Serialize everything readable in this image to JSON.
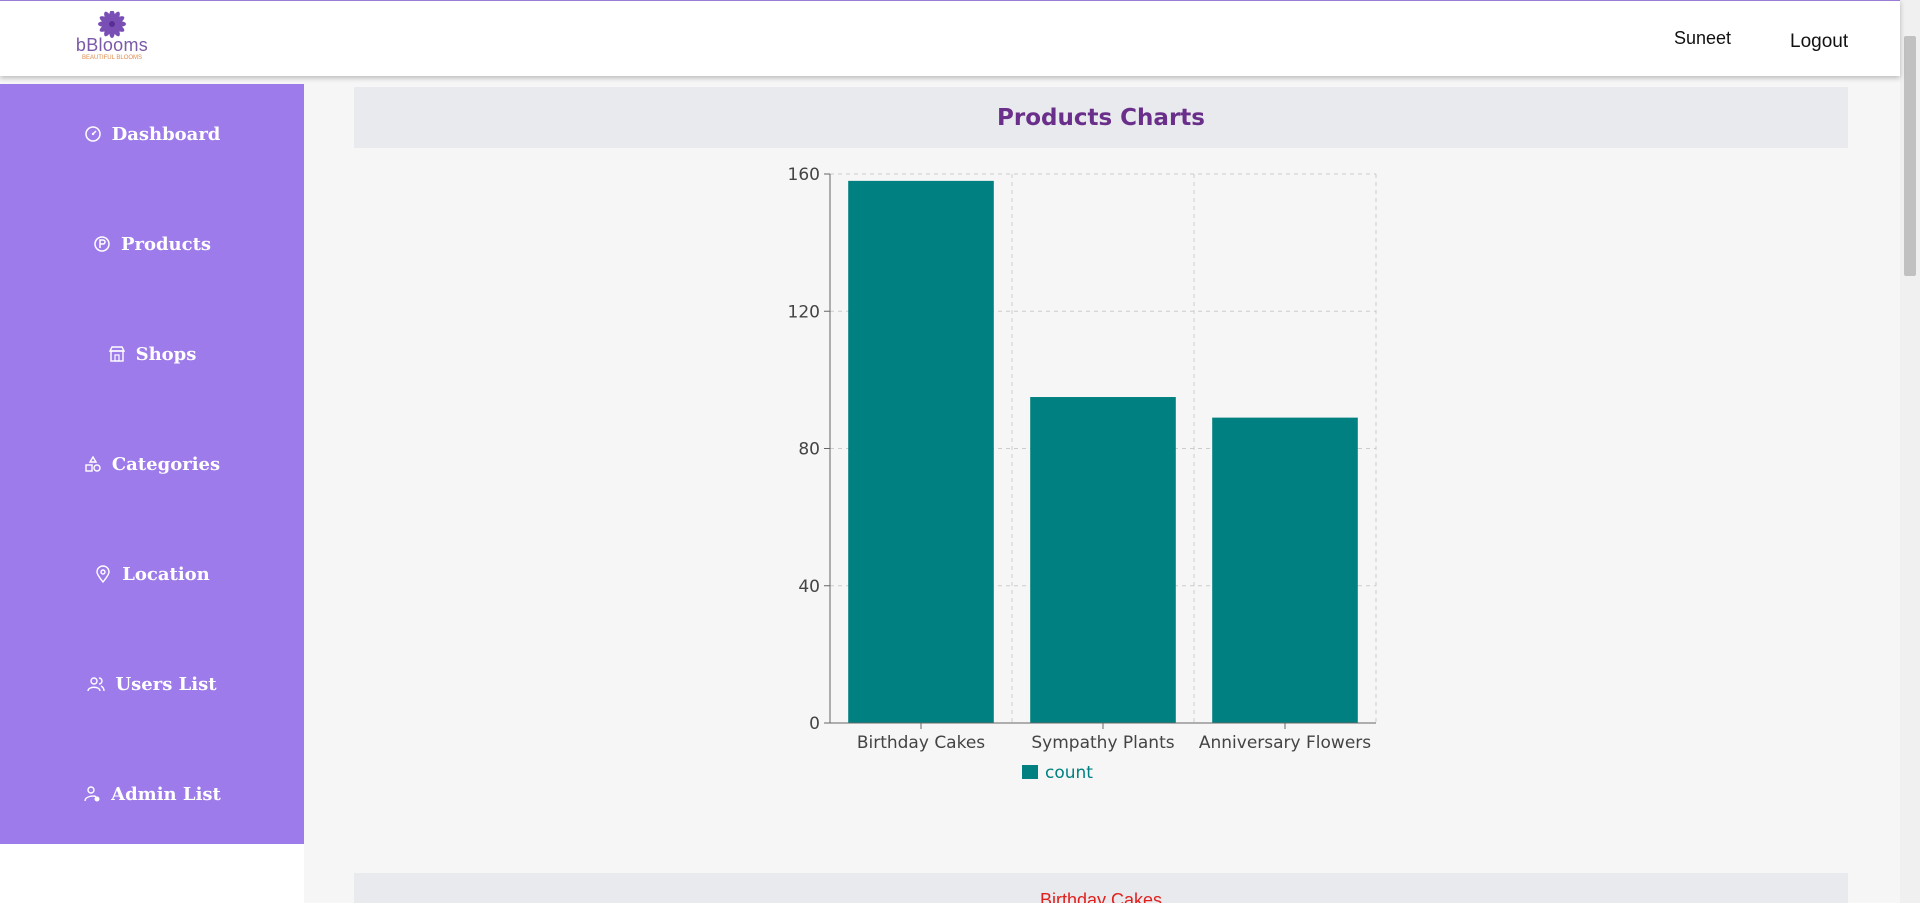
{
  "app": {
    "logo_text": "bBlooms",
    "logo_tagline": "BEAUTIFUL BLOOMS",
    "user_name": "Suneet",
    "logout_label": "Logout"
  },
  "sidebar": {
    "items": [
      {
        "label": "Dashboard",
        "icon": "dashboard-gauge-icon"
      },
      {
        "label": "Products",
        "icon": "product-p-icon"
      },
      {
        "label": "Shops",
        "icon": "shop-storefront-icon"
      },
      {
        "label": "Categories",
        "icon": "shapes-icon"
      },
      {
        "label": "Location",
        "icon": "location-pin-icon"
      },
      {
        "label": "Users List",
        "icon": "users-icon"
      },
      {
        "label": "Admin List",
        "icon": "admin-user-icon"
      }
    ]
  },
  "main": {
    "chart_section_title": "Products Charts",
    "next_section_title": "Birthday Cakes"
  },
  "colors": {
    "sidebar": "#9e7bea",
    "bar": "#008080",
    "title": "#6a2f8a",
    "next_section_title": "#e0201e"
  },
  "chart_data": {
    "type": "bar",
    "title": "",
    "xlabel": "",
    "ylabel": "",
    "categories": [
      "Birthday Cakes",
      "Sympathy Plants",
      "Anniversary Flowers"
    ],
    "series": [
      {
        "name": "count",
        "values": [
          158,
          95,
          89
        ]
      }
    ],
    "ylim": [
      0,
      160
    ],
    "yticks": [
      0,
      40,
      80,
      120,
      160
    ],
    "grid": true,
    "legend": "bottom"
  }
}
